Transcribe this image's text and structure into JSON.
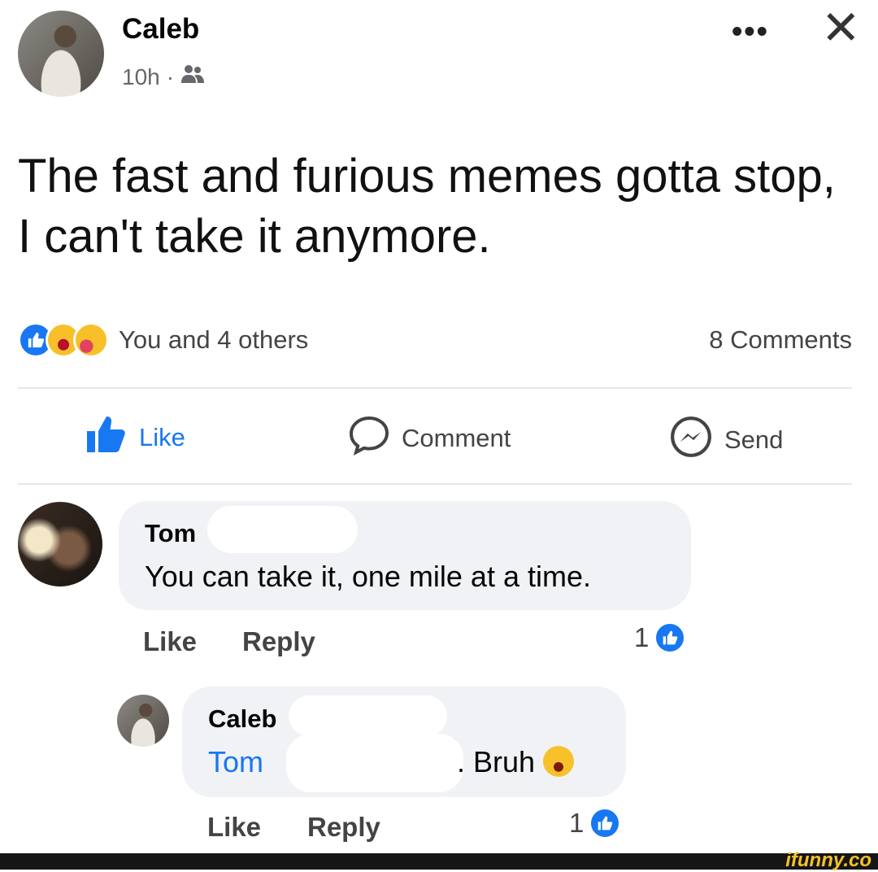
{
  "post": {
    "author": "Caleb",
    "time": "10h",
    "separator": "·",
    "audience_icon": "friends-icon",
    "text": "The fast and furious memes gotta stop, I can't take it anymore.",
    "reactions_text": "You and 4 others",
    "comments_count": "8 Comments",
    "reaction_icons": [
      "like-icon",
      "haha-icon",
      "care-icon"
    ]
  },
  "header": {
    "more_glyph": "•••",
    "close_glyph": "✕"
  },
  "actions": {
    "like": "Like",
    "comment": "Comment",
    "send": "Send"
  },
  "comments": [
    {
      "name": "Tom",
      "text": "You can take it, one mile at a time.",
      "like": "Like",
      "reply": "Reply",
      "likes": "1"
    },
    {
      "name": "Caleb",
      "mention": "Tom",
      "text_after": ". Bruh",
      "emoji": "laughing-emoji",
      "like": "Like",
      "reply": "Reply",
      "likes": "1"
    }
  ],
  "watermark": "ifunny.co",
  "colors": {
    "accent": "#1877f2",
    "bubble": "#f0f2f5",
    "secondary_text": "#65676b"
  }
}
